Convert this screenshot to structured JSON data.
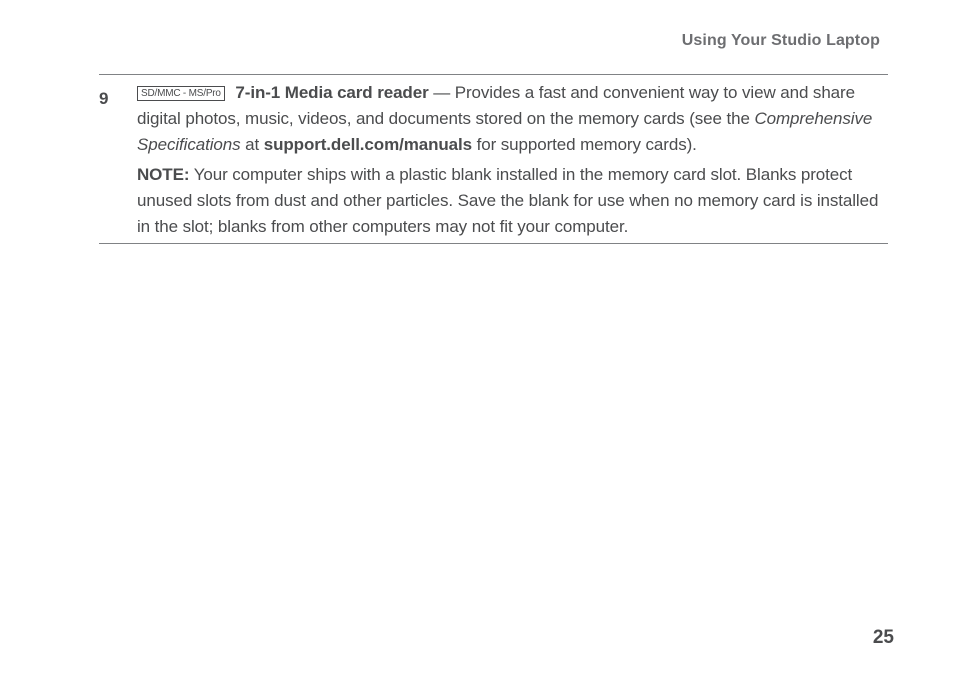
{
  "header": "Using Your Studio Laptop",
  "item_number": "9",
  "icon_label": "SD/MMC - MS/Pro",
  "feature_name": "7-in-1 Media card reader",
  "feature_sep": " — ",
  "feature_text_a": "Provides a fast and convenient way to view and share digital photos, music, videos, and documents stored on the memory cards (see the ",
  "feature_italic": "Comprehensive Specifications",
  "feature_text_b": " at ",
  "feature_bold_url": "support.dell.com/manuals",
  "feature_text_c": " for supported memory cards).",
  "note_label": "NOTE:",
  "note_text": " Your computer ships with a plastic blank installed in the memory card slot. Blanks protect unused slots from dust and other particles. Save the blank for use when no memory card is installed in the slot; blanks from other computers may not fit your computer.",
  "page_number": "25"
}
